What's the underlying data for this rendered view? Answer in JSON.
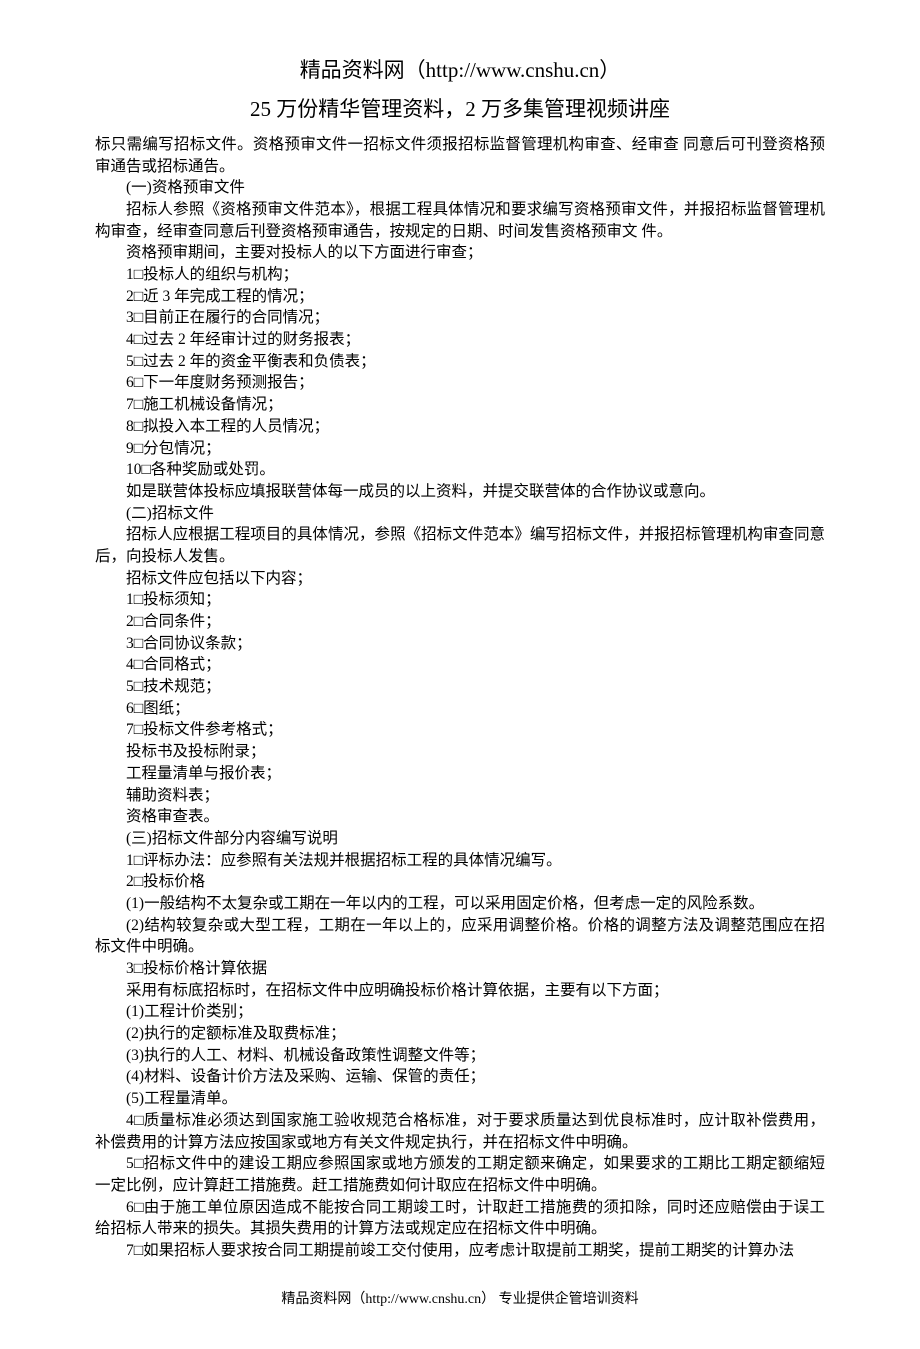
{
  "header": {
    "line1": "精品资料网（http://www.cnshu.cn）",
    "line2": "25 万份精华管理资料，2 万多集管理视频讲座"
  },
  "body": {
    "p0": "标只需编写招标文件。资格预审文件一招标文件须报招标监督管理机构审查、经审查 同意后可刊登资格预审通告或招标通告。",
    "s1title": "(一)资格预审文件",
    "s1p1": "招标人参照《资格预审文件范本》，根据工程具体情况和要求编写资格预审文件，并报招标监督管理机构审查，经审查同意后刊登资格预审通告，按规定的日期、时间发售资格预审文 件。",
    "s1p2": "资格预审期间，主要对投标人的以下方面进行审查；",
    "s1i1": "1□投标人的组织与机构；",
    "s1i2": "2□近 3 年完成工程的情况；",
    "s1i3": "3□目前正在履行的合同情况；",
    "s1i4": "4□过去 2 年经审计过的财务报表；",
    "s1i5": "5□过去 2 年的资金平衡表和负债表；",
    "s1i6": "6□下一年度财务预测报告；",
    "s1i7": "7□施工机械设备情况；",
    "s1i8": "8□拟投入本工程的人员情况；",
    "s1i9": "9□分包情况；",
    "s1i10": "10□各种奖励或处罚。",
    "s1p3": "如是联营体投标应填报联营体每一成员的以上资料，并提交联营体的合作协议或意向。",
    "s2title": "(二)招标文件",
    "s2p1": "招标人应根据工程项目的具体情况，参照《招标文件范本》编写招标文件，并报招标管理机构审查同意后，向投标人发售。",
    "s2p2": "招标文件应包括以下内容；",
    "s2i1": "1□投标须知；",
    "s2i2": "2□合同条件；",
    "s2i3": "3□合同协议条款；",
    "s2i4": "4□合同格式；",
    "s2i5": "5□技术规范；",
    "s2i6": "6□图纸；",
    "s2i7": "7□投标文件参考格式；",
    "s2i8": "投标书及投标附录；",
    "s2i9": "工程量清单与报价表；",
    "s2i10": "辅助资料表；",
    "s2i11": "资格审查表。",
    "s3title": "(三)招标文件部分内容编写说明",
    "s3i1": "1□评标办法：应参照有关法规并根据招标工程的具体情况编写。",
    "s3i2": "2□投标价格",
    "s3p1": "(1)一般结构不太复杂或工期在一年以内的工程，可以采用固定价格，但考虑一定的风险系数。",
    "s3p2": "(2)结构较复杂或大型工程，工期在一年以上的，应采用调整价格。价格的调整方法及调整范围应在招标文件中明确。",
    "s3i3": "3□投标价格计算依据",
    "s3p3": "采用有标底招标时，在招标文件中应明确投标价格计算依据，主要有以下方面；",
    "s3p4": "(1)工程计价类别；",
    "s3p5": "(2)执行的定额标准及取费标准；",
    "s3p6": "(3)执行的人工、材料、机械设备政策性调整文件等；",
    "s3p7": "(4)材料、设备计价方法及采购、运输、保管的责任；",
    "s3p8": "(5)工程量清单。",
    "s3i4": "4□质量标准必须达到国家施工验收规范合格标准，对于要求质量达到优良标准时，应计取补偿费用，补偿费用的计算方法应按国家或地方有关文件规定执行，并在招标文件中明确。",
    "s3i5": "5□招标文件中的建设工期应参照国家或地方颁发的工期定额来确定，如果要求的工期比工期定额缩短一定比例，应计算赶工措施费。赶工措施费如何计取应在招标文件中明确。",
    "s3i6": "6□由于施工单位原因造成不能按合同工期竣工时，计取赶工措施费的须扣除，同时还应赔偿由于误工给招标人带来的损失。其损失费用的计算方法或规定应在招标文件中明确。",
    "s3i7": "7□如果招标人要求按合同工期提前竣工交付使用，应考虑计取提前工期奖，提前工期奖的计算办法"
  },
  "footer": {
    "text": "精品资料网（http://www.cnshu.cn） 专业提供企管培训资料"
  }
}
